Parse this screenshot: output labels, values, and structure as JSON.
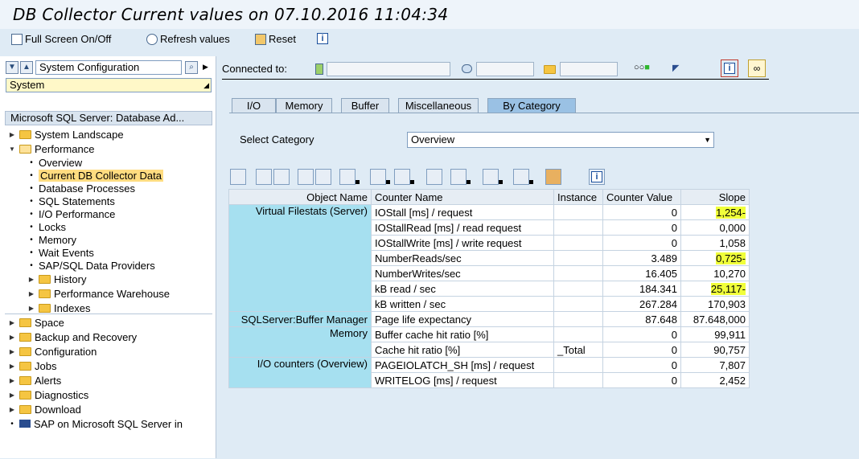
{
  "window": {
    "title": "DB Collector Current values on 07.10.2016 11:04:34"
  },
  "toolbar": {
    "fullscreen_label": "Full Screen On/Off",
    "refresh_label": "Refresh values",
    "reset_label": "Reset"
  },
  "nav": {
    "config_label": "System Configuration",
    "system_label": "System"
  },
  "tree": {
    "header": "Microsoft SQL Server: Database Ad...",
    "items": [
      "System Landscape",
      "Performance",
      "Overview",
      "Current DB Collector Data",
      "Database Processes",
      "SQL Statements",
      "I/O Performance",
      "Locks",
      "Memory",
      "Wait Events",
      "SAP/SQL Data Providers",
      "History",
      "Performance Warehouse",
      "Indexes",
      "Space",
      "Backup and Recovery",
      "Configuration",
      "Jobs",
      "Alerts",
      "Diagnostics",
      "Download",
      "SAP on Microsoft SQL Server in"
    ]
  },
  "connection": {
    "label": "Connected to:"
  },
  "tabs": [
    "I/O",
    "Memory",
    "Buffer",
    "Miscellaneous",
    "By Category"
  ],
  "category": {
    "label": "Select Category",
    "value": "Overview"
  },
  "table": {
    "headers": [
      "Object Name",
      "Counter Name",
      "Instance",
      "Counter Value",
      "Slope"
    ],
    "rows": [
      [
        "Virtual Filestats (Server)",
        "IOStall [ms] / request",
        "",
        "0",
        "1,254-"
      ],
      [
        "",
        "IOStallRead [ms] / read request",
        "",
        "0",
        "0,000"
      ],
      [
        "",
        "IOStallWrite [ms] / write request",
        "",
        "0",
        "1,058"
      ],
      [
        "",
        "NumberReads/sec",
        "",
        "3.489",
        "0,725-"
      ],
      [
        "",
        "NumberWrites/sec",
        "",
        "16.405",
        "10,270"
      ],
      [
        "",
        "kB read / sec",
        "",
        "184.341",
        "25,117-"
      ],
      [
        "",
        "kB written / sec",
        "",
        "267.284",
        "170,903"
      ],
      [
        "SQLServer:Buffer Manager",
        "Page life expectancy",
        "",
        "87.648",
        "87.648,000"
      ],
      [
        "Memory",
        "Buffer cache hit ratio [%]",
        "",
        "0",
        "99,911"
      ],
      [
        "",
        "Cache hit ratio [%]",
        "_Total",
        "0",
        "90,757"
      ],
      [
        "I/O counters (Overview)",
        "PAGEIOLATCH_SH [ms] / request",
        "",
        "0",
        "7,807"
      ],
      [
        "",
        "WRITELOG [ms] / request",
        "",
        "0",
        "2,452"
      ]
    ]
  },
  "colors": {
    "highlight": "#f0ff3a",
    "object_cell": "#a6e0f0",
    "active_tab": "#9ac1e4"
  }
}
